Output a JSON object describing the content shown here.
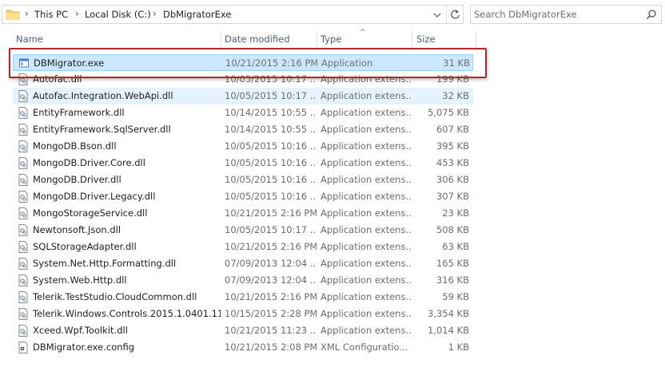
{
  "breadcrumb": [
    "This PC",
    "Local Disk (C:)",
    "DbMigratorExe"
  ],
  "search": {
    "placeholder": "Search DbMigratorExe"
  },
  "columns": {
    "name": "Name",
    "date": "Date modified",
    "type": "Type",
    "size": "Size"
  },
  "files": [
    {
      "name": "DBMigrator.exe",
      "date": "10/21/2015 2:16 PM",
      "type": "Application",
      "size": "31 KB",
      "icon": "exe-icon",
      "state": "selected"
    },
    {
      "name": "Autofac.dll",
      "date": "10/05/2015 10:17 ...",
      "type": "Application extens...",
      "size": "199 KB",
      "icon": "dll-icon",
      "state": ""
    },
    {
      "name": "Autofac.Integration.WebApi.dll",
      "date": "10/05/2015 10:17 ...",
      "type": "Application extens...",
      "size": "32 KB",
      "icon": "dll-icon",
      "state": "hover"
    },
    {
      "name": "EntityFramework.dll",
      "date": "10/14/2015 10:55 ...",
      "type": "Application extens...",
      "size": "5,075 KB",
      "icon": "dll-icon",
      "state": ""
    },
    {
      "name": "EntityFramework.SqlServer.dll",
      "date": "10/14/2015 10:55 ...",
      "type": "Application extens...",
      "size": "607 KB",
      "icon": "dll-icon",
      "state": ""
    },
    {
      "name": "MongoDB.Bson.dll",
      "date": "10/05/2015 10:16 ...",
      "type": "Application extens...",
      "size": "395 KB",
      "icon": "dll-icon",
      "state": ""
    },
    {
      "name": "MongoDB.Driver.Core.dll",
      "date": "10/05/2015 10:16 ...",
      "type": "Application extens...",
      "size": "453 KB",
      "icon": "dll-icon",
      "state": ""
    },
    {
      "name": "MongoDB.Driver.dll",
      "date": "10/05/2015 10:16 ...",
      "type": "Application extens...",
      "size": "306 KB",
      "icon": "dll-icon",
      "state": ""
    },
    {
      "name": "MongoDB.Driver.Legacy.dll",
      "date": "10/05/2015 10:16 ...",
      "type": "Application extens...",
      "size": "307 KB",
      "icon": "dll-icon",
      "state": ""
    },
    {
      "name": "MongoStorageService.dll",
      "date": "10/21/2015 2:16 PM",
      "type": "Application extens...",
      "size": "23 KB",
      "icon": "dll-icon",
      "state": ""
    },
    {
      "name": "Newtonsoft.Json.dll",
      "date": "10/05/2015 10:17 ...",
      "type": "Application extens...",
      "size": "508 KB",
      "icon": "dll-icon",
      "state": ""
    },
    {
      "name": "SQLStorageAdapter.dll",
      "date": "10/21/2015 2:16 PM",
      "type": "Application extens...",
      "size": "63 KB",
      "icon": "dll-icon",
      "state": ""
    },
    {
      "name": "System.Net.Http.Formatting.dll",
      "date": "07/09/2013 12:04 ...",
      "type": "Application extens...",
      "size": "165 KB",
      "icon": "dll-icon",
      "state": ""
    },
    {
      "name": "System.Web.Http.dll",
      "date": "07/09/2013 12:04 ...",
      "type": "Application extens...",
      "size": "316 KB",
      "icon": "dll-icon",
      "state": ""
    },
    {
      "name": "Telerik.TestStudio.CloudCommon.dll",
      "date": "10/21/2015 2:16 PM",
      "type": "Application extens...",
      "size": "59 KB",
      "icon": "dll-icon",
      "state": ""
    },
    {
      "name": "Telerik.Windows.Controls.2015.1.0401.11...",
      "date": "10/15/2015 2:28 PM",
      "type": "Application extens...",
      "size": "3,354 KB",
      "icon": "dll-icon",
      "state": ""
    },
    {
      "name": "Xceed.Wpf.Toolkit.dll",
      "date": "10/21/2015 11:23 ...",
      "type": "Application extens...",
      "size": "1,014 KB",
      "icon": "dll-icon",
      "state": ""
    },
    {
      "name": "DBMigrator.exe.config",
      "date": "10/21/2015 2:08 PM",
      "type": "XML Configuratio...",
      "size": "1 KB",
      "icon": "config-icon",
      "state": ""
    }
  ],
  "colors": {
    "selected_bg": "#cce8ff",
    "hover_bg": "#e5f3ff",
    "highlight_border": "#b5262c",
    "header_text": "#4c607a"
  }
}
